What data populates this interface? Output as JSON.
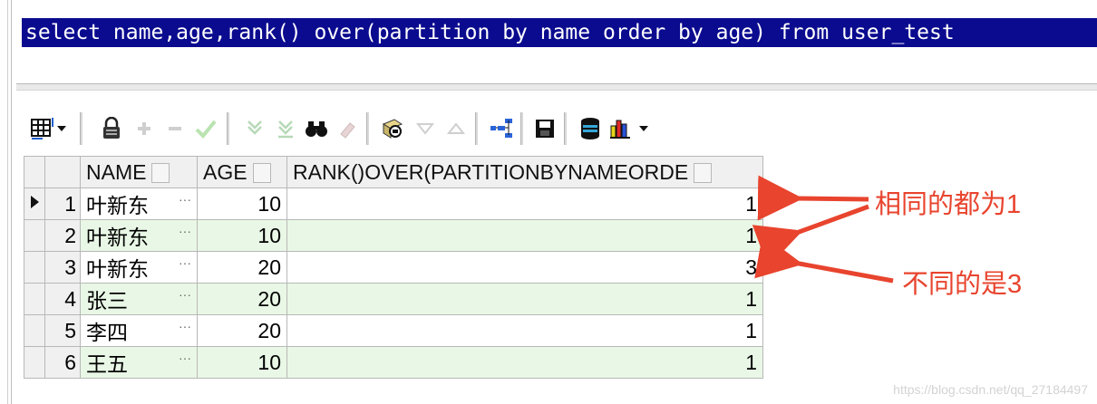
{
  "editor": {
    "sql": "select name,age,rank() over(partition by name order by age) from user_test"
  },
  "grid": {
    "columns": [
      "NAME",
      "AGE",
      "RANK()OVER(PARTITIONBYNAMEORDE"
    ],
    "rows": [
      {
        "num": "1",
        "name": "叶新东",
        "age": "10",
        "rank": "1"
      },
      {
        "num": "2",
        "name": "叶新东",
        "age": "10",
        "rank": "1"
      },
      {
        "num": "3",
        "name": "叶新东",
        "age": "20",
        "rank": "3"
      },
      {
        "num": "4",
        "name": "张三",
        "age": "20",
        "rank": "1"
      },
      {
        "num": "5",
        "name": "李四",
        "age": "20",
        "rank": "1"
      },
      {
        "num": "6",
        "name": "王五",
        "age": "10",
        "rank": "1"
      }
    ],
    "ellipsis": "···"
  },
  "annotations": {
    "same": "相同的都为1",
    "different": "不同的是3"
  },
  "watermark": "https://blog.csdn.net/qq_27184497",
  "colors": {
    "sql_bg": "#0b0b8f",
    "alt_row": "#e9f8e6",
    "annotation": "#e8442e"
  },
  "icons": [
    "grid-icon",
    "dropdown-icon",
    "lock-icon",
    "plus-icon",
    "minus-icon",
    "check-icon",
    "filter-icon",
    "filter-clear-icon",
    "binoculars-icon",
    "eraser-icon",
    "query-icon",
    "triangle-down-icon",
    "triangle-up-icon",
    "tree-icon",
    "save-icon",
    "database-icon",
    "chart-icon",
    "dropdown-icon"
  ]
}
